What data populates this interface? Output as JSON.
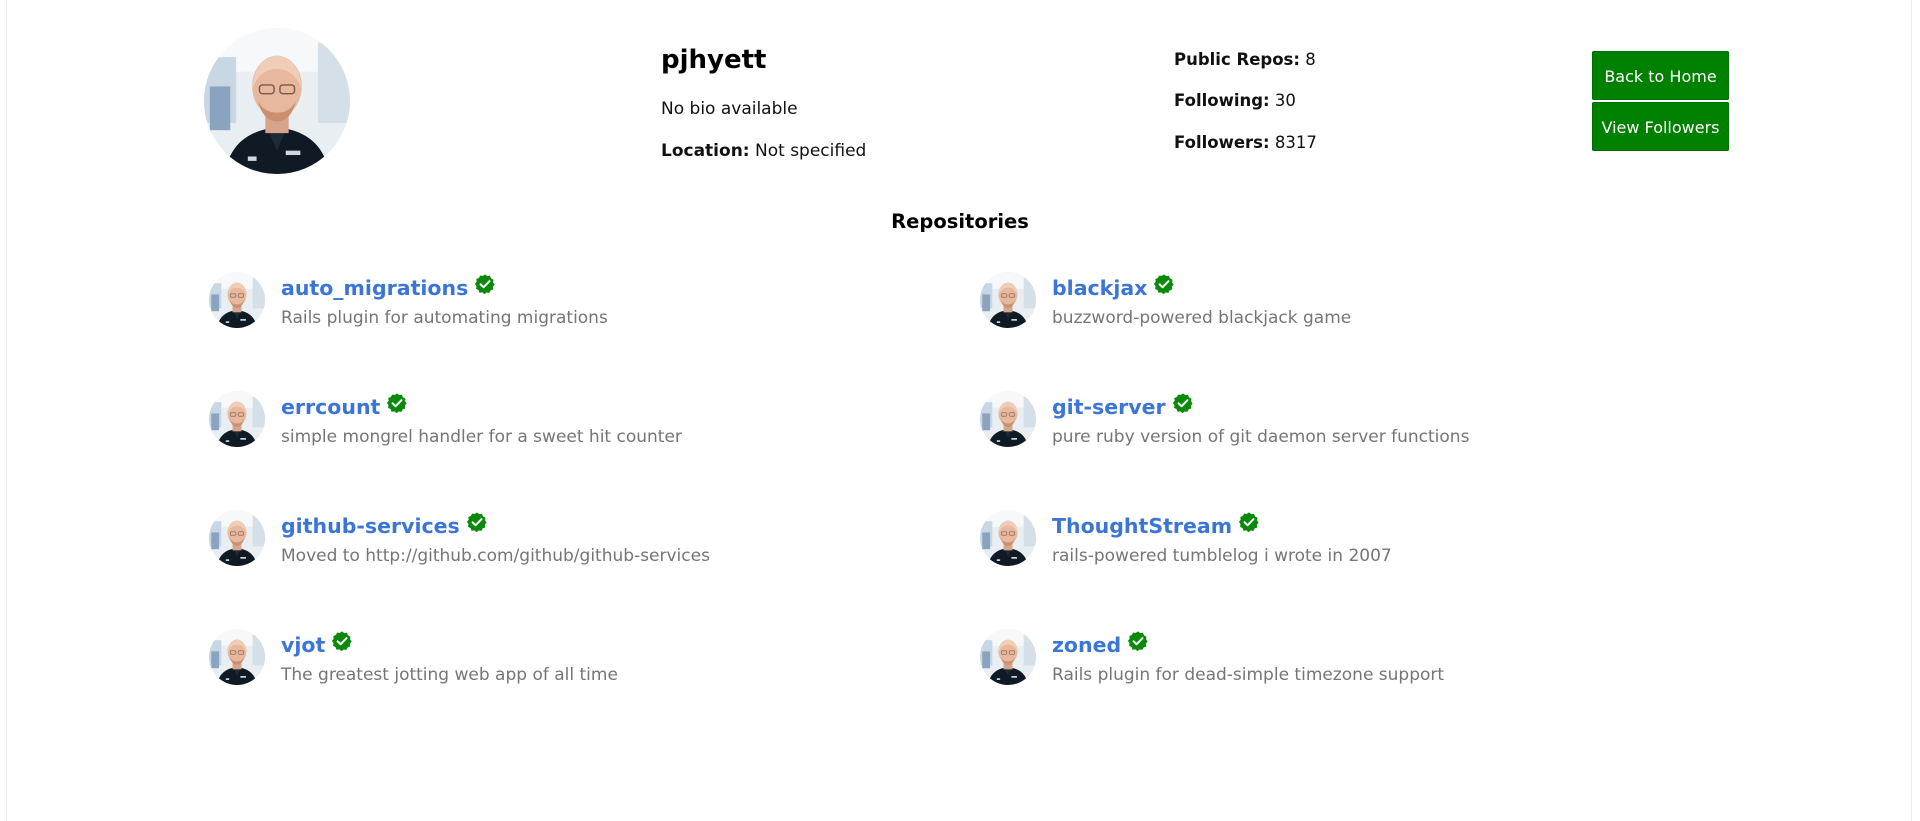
{
  "profile": {
    "username": "pjhyett",
    "bio": "No bio available",
    "location_label": "Location:",
    "location_value": "Not specified"
  },
  "stats": {
    "public_repos_label": "Public Repos:",
    "public_repos_value": "8",
    "following_label": "Following:",
    "following_value": "30",
    "followers_label": "Followers:",
    "followers_value": "8317"
  },
  "buttons": {
    "back_home": "Back to Home",
    "view_followers": "View Followers"
  },
  "repositories": {
    "title": "Repositories",
    "items": [
      {
        "name": "auto_migrations",
        "description": "Rails plugin for automating migrations"
      },
      {
        "name": "blackjax",
        "description": "buzzword-powered blackjack game"
      },
      {
        "name": "errcount",
        "description": "simple mongrel handler for a sweet hit counter"
      },
      {
        "name": "git-server",
        "description": "pure ruby version of git daemon server functions"
      },
      {
        "name": "github-services",
        "description": "Moved to http://github.com/github/github-services"
      },
      {
        "name": "ThoughtStream",
        "description": "rails-powered tumblelog i wrote in 2007"
      },
      {
        "name": "vjot",
        "description": "The greatest jotting web app of all time"
      },
      {
        "name": "zoned",
        "description": "Rails plugin for dead-simple timezone support"
      }
    ]
  },
  "colors": {
    "button_green": "#008000",
    "repo_link_blue": "#3b76d6",
    "description_gray": "#757575",
    "verified_badge_green": "#0a8a0a"
  },
  "icons": {
    "verified": "verified-badge-icon"
  }
}
